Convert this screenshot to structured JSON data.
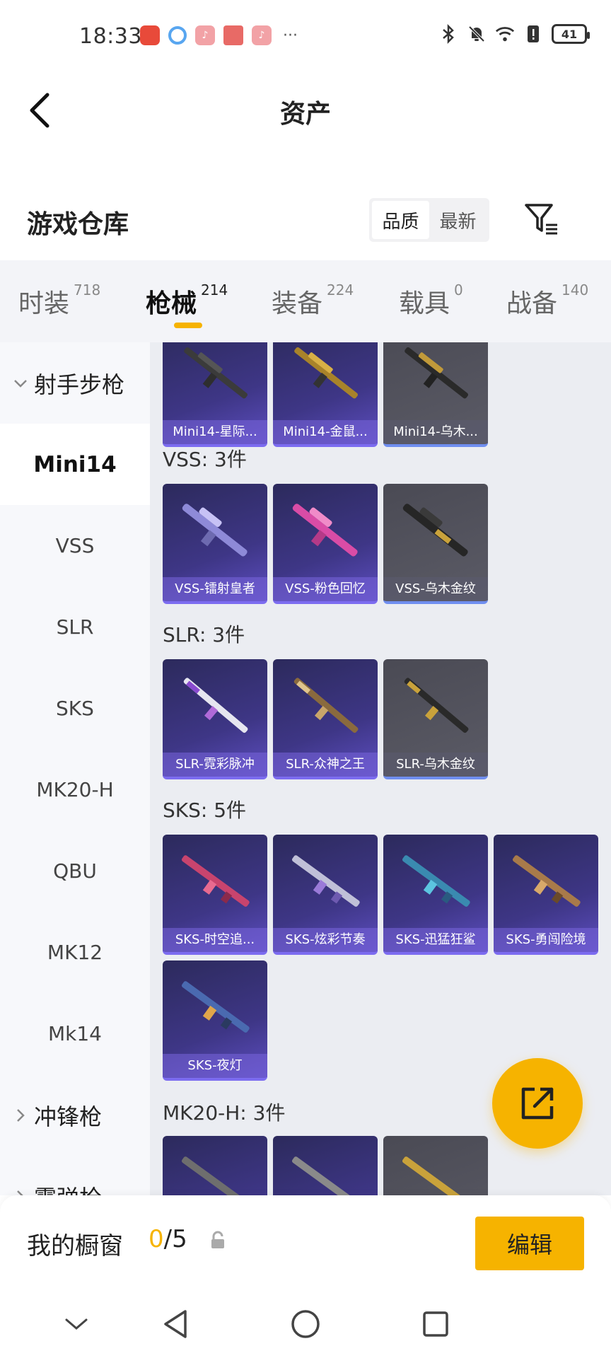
{
  "status_bar": {
    "time": "18:33",
    "battery": "41",
    "notif_more": "···"
  },
  "header": {
    "title": "资产"
  },
  "warehouse": {
    "title": "游戏仓库",
    "sort_options": [
      "品质",
      "最新"
    ],
    "sort_active": "品质"
  },
  "tabs": [
    {
      "label": "时装",
      "count": "718"
    },
    {
      "label": "枪械",
      "count": "214"
    },
    {
      "label": "装备",
      "count": "224"
    },
    {
      "label": "载具",
      "count": "0"
    },
    {
      "label": "战备",
      "count": "140"
    }
  ],
  "sidebar": {
    "group1": "射手步枪",
    "items": [
      "Mini14",
      "VSS",
      "SLR",
      "SKS",
      "MK20-H",
      "QBU",
      "MK12",
      "Mk14"
    ],
    "group2": "冲锋枪",
    "group3_partial": "霰弹枪"
  },
  "content": {
    "mini14_cards": [
      "Mini14-星际...",
      "Mini14-金鼠...",
      "Mini14-乌木..."
    ],
    "vss_head": "VSS: 3件",
    "vss_cards": [
      "VSS-镭射皇者",
      "VSS-粉色回忆",
      "VSS-乌木金纹"
    ],
    "slr_head": "SLR: 3件",
    "slr_cards": [
      "SLR-霓彩脉冲",
      "SLR-众神之王",
      "SLR-乌木金纹"
    ],
    "sks_head": "SKS: 5件",
    "sks_cards": [
      "SKS-时空追...",
      "SKS-炫彩节奏",
      "SKS-迅猛狂鲨",
      "SKS-勇闯险境",
      "SKS-夜灯"
    ],
    "mk20_head": "MK20-H: 3件"
  },
  "showcase": {
    "title": "我的橱窗",
    "current": "0",
    "total": "/5",
    "edit_label": "编辑"
  },
  "colors": {
    "accent": "#f6b300",
    "card_purple": "#3e3686",
    "card_gray": "#55555f"
  }
}
